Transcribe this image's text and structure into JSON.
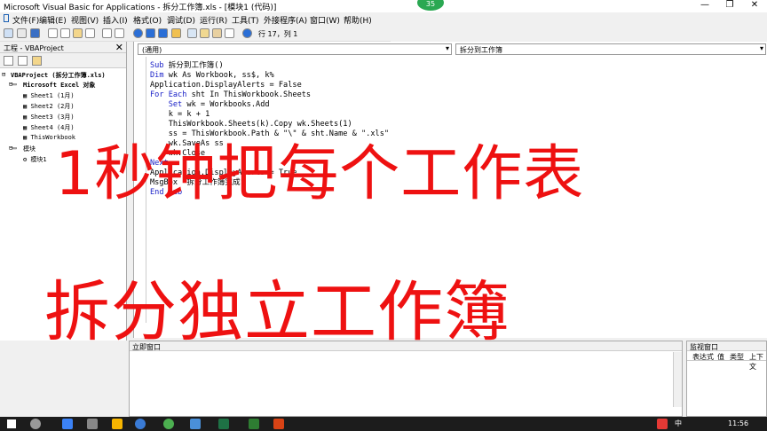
{
  "window": {
    "title": "Microsoft Visual Basic for Applications - 拆分工作簿.xls - [模块1 (代码)]",
    "badge": "35",
    "controls": [
      "—",
      "❐",
      "✕"
    ]
  },
  "menu": [
    "文件(F)",
    "编辑(E)",
    "视图(V)",
    "插入(I)",
    "格式(O)",
    "调试(D)",
    "运行(R)",
    "工具(T)",
    "外接程序(A)",
    "窗口(W)",
    "帮助(H)"
  ],
  "toolbar": {
    "status": "行 17，列 1"
  },
  "project": {
    "title": "工程 - VBAProject",
    "close": "✕",
    "root": "VBAProject (拆分工作簿.xls)",
    "excel_folder": "Microsoft Excel 对象",
    "sheets": [
      "Sheet1 (1月)",
      "Sheet2 (2月)",
      "Sheet3 (3月)",
      "Sheet4 (4月)",
      "ThisWorkbook"
    ],
    "modules_folder": "模块",
    "module": "模块1"
  },
  "code_window": {
    "object_combo": "(通用)",
    "proc_combo": "拆分到工作簿",
    "arrow": "▾",
    "lines": [
      {
        "indent": 0,
        "kw": "Sub",
        "rest": " 拆分到工作簿()"
      },
      {
        "indent": 0,
        "kw": "Dim",
        "rest": " wk As Workbook, ss$, k%"
      },
      {
        "indent": 0,
        "kw": "",
        "rest": "Application.DisplayAlerts = False"
      },
      {
        "indent": 0,
        "kw": "For Each",
        "rest": " sht In ThisWorkbook.Sheets"
      },
      {
        "indent": 1,
        "kw": "Set",
        "rest": " wk = Workbooks.Add"
      },
      {
        "indent": 1,
        "kw": "",
        "rest": "k = k + 1"
      },
      {
        "indent": 1,
        "kw": "",
        "rest": "ThisWorkbook.Sheets(k).Copy wk.Sheets(1)"
      },
      {
        "indent": 1,
        "kw": "",
        "rest": "ss = ThisWorkbook.Path & \"\\\" & sht.Name & \".xls\""
      },
      {
        "indent": 1,
        "kw": "",
        "rest": "wk.SaveAs ss"
      },
      {
        "indent": 1,
        "kw": "",
        "rest": "wk.Close"
      },
      {
        "indent": 0,
        "kw": "Next",
        "rest": ""
      },
      {
        "indent": 0,
        "kw": "",
        "rest": "Application.DisplayAlerts = True"
      },
      {
        "indent": 0,
        "kw": "",
        "rest": "MsgBox \"拆分工作簿完成\""
      },
      {
        "indent": 0,
        "kw": "End Sub",
        "rest": ""
      }
    ]
  },
  "overlay": {
    "line1": "1秒钟把每个工作表",
    "line2": "拆分独立工作簿",
    "color": "#ee1111"
  },
  "immediate": {
    "title": "立即窗口"
  },
  "watch": {
    "title": "监视窗口",
    "cols": [
      "表达式",
      "值",
      "类型",
      "上下文"
    ]
  },
  "taskbar": {
    "time": "11:56",
    "ime": "中"
  }
}
